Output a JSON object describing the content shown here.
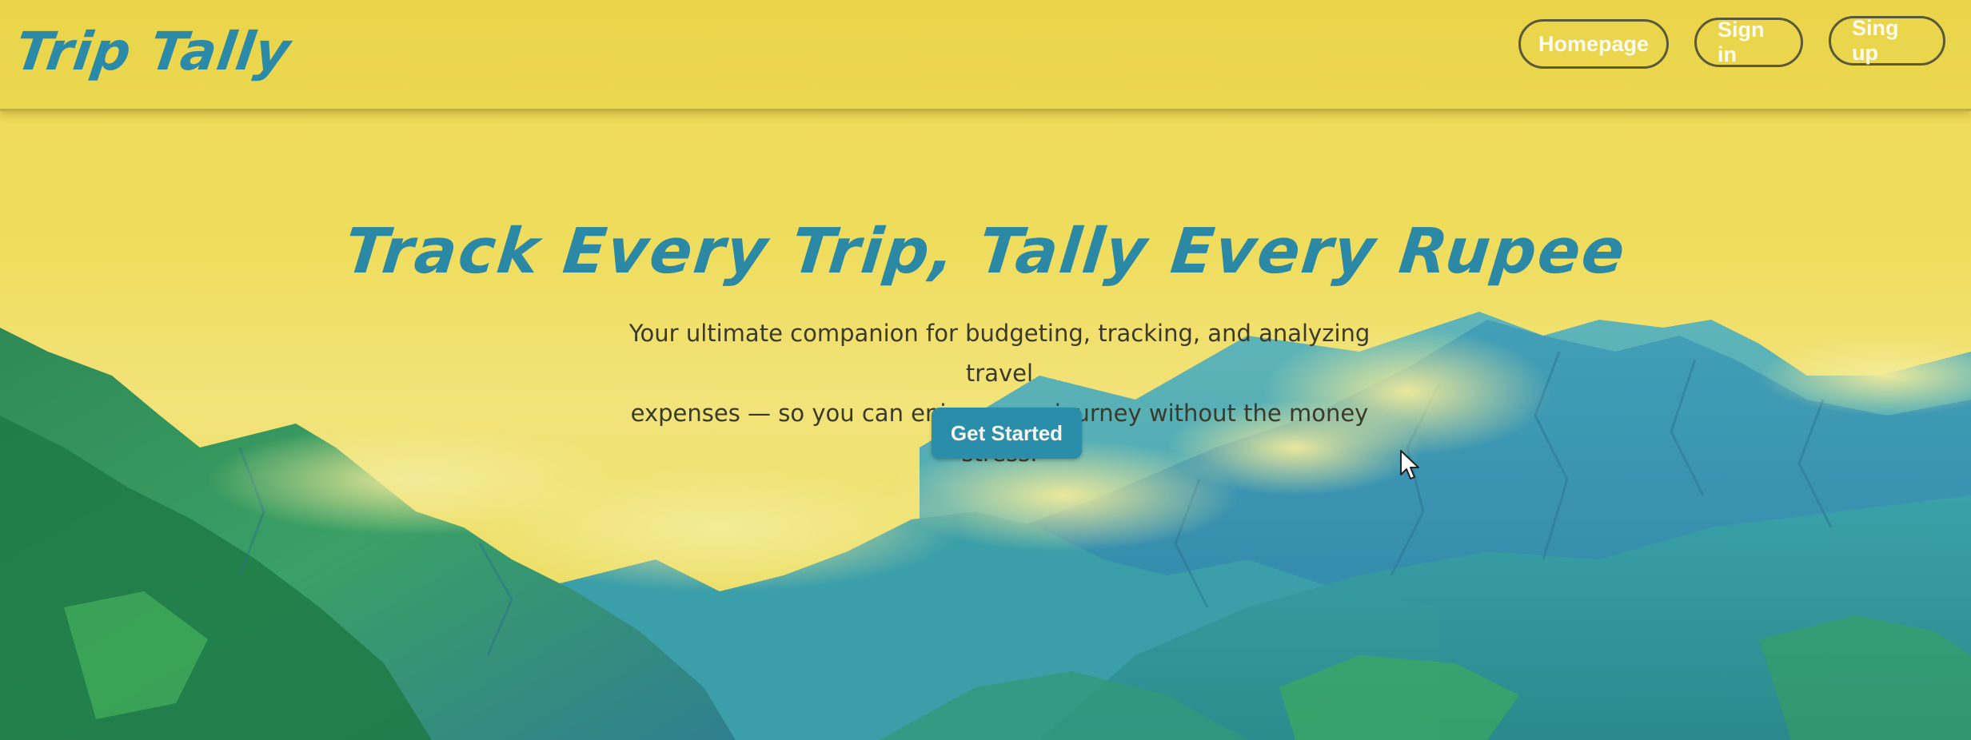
{
  "navbar": {
    "logo": "Trip Tally",
    "buttons": {
      "homepage": "Homepage",
      "sign_in": "Sign in",
      "sign_up": "Sing up"
    }
  },
  "hero": {
    "title": "Track Every Trip, Tally Every Rupee",
    "subtitle_line1": "Your ultimate companion for budgeting, tracking, and analyzing travel",
    "subtitle_line2": "expenses — so you can enjoy every journey without the money stress.",
    "cta_label": "Get Started"
  },
  "colors": {
    "background": "#f0dc55",
    "accent": "#2a8aa8",
    "nav_button_text": "#fbfbf0"
  },
  "icons": {
    "cursor": "mouse-pointer-icon"
  }
}
